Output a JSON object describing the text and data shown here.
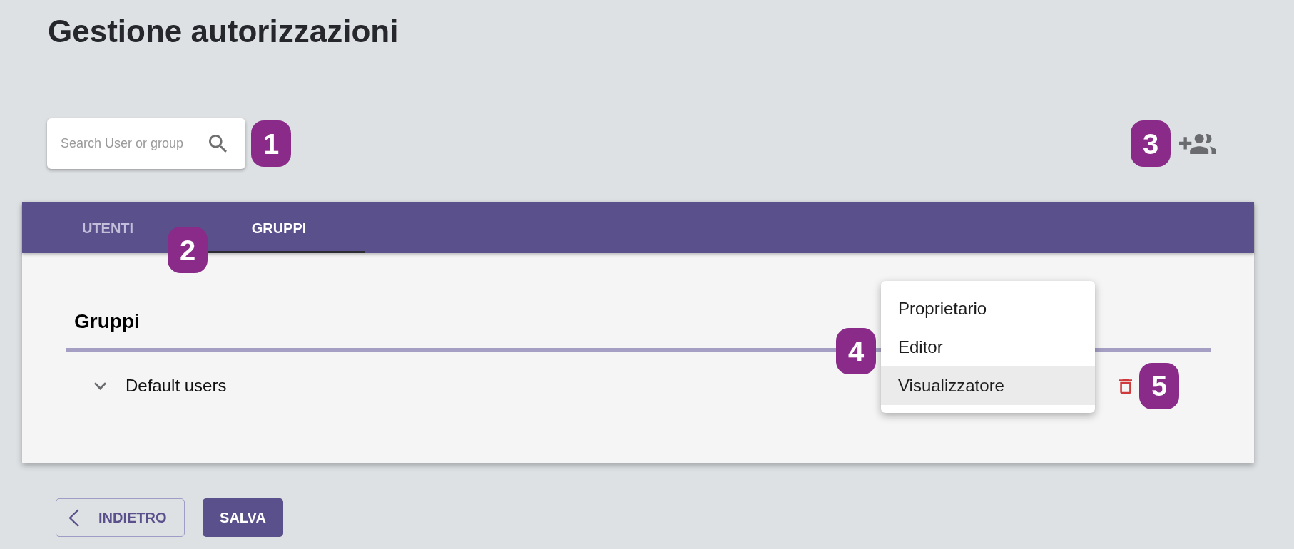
{
  "title": "Gestione autorizzazioni",
  "search": {
    "placeholder": "Search User or group",
    "callout": "1"
  },
  "add_group": {
    "callout": "3"
  },
  "tab_bar": {
    "callout": "2",
    "tabs": [
      {
        "label": "UTENTI",
        "selected": false
      },
      {
        "label": "GRUPPI",
        "selected": true
      }
    ]
  },
  "panel": {
    "title": "Gruppi",
    "groups": [
      {
        "name": "Default users",
        "expanded": false,
        "callout": "5"
      }
    ]
  },
  "role_menu": {
    "callout": "4",
    "items": [
      {
        "label": "Proprietario",
        "selected": false
      },
      {
        "label": "Editor",
        "selected": false
      },
      {
        "label": "Visualizzatore",
        "selected": true
      }
    ]
  },
  "buttons": [
    {
      "label": "INDIETRO",
      "kind": "back"
    },
    {
      "label": "SALVA",
      "kind": "primary"
    }
  ]
}
